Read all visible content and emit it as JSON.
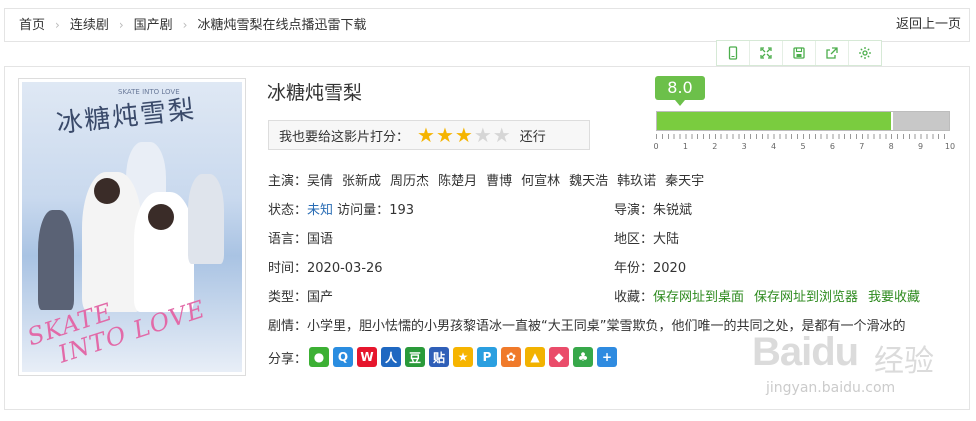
{
  "breadcrumb": {
    "items": [
      "首页",
      "连续剧",
      "国产剧",
      "冰糖炖雪梨在线点播迅雷下载"
    ],
    "separator": "›",
    "back": "返回上一页"
  },
  "toolbar": {
    "icons": [
      "mobile-icon",
      "fullscreen-icon",
      "save-icon",
      "share-out-icon",
      "settings-icon"
    ],
    "color": "#4cae4c"
  },
  "poster": {
    "title": "冰糖炖雪梨",
    "subtitle": "SKATE INTO LOVE",
    "script": [
      "SKATE",
      "INTO LOVE"
    ]
  },
  "movie": {
    "title": "冰糖炖雪梨"
  },
  "rating": {
    "prompt": "我也要给这影片打分：",
    "stars_on": 3,
    "stars_total": 5,
    "verdict": "还行"
  },
  "score": {
    "value": "8.0",
    "fraction": 0.8,
    "scale": [
      "0",
      "1",
      "2",
      "3",
      "4",
      "5",
      "6",
      "7",
      "8",
      "9",
      "10"
    ],
    "color": "#7acc3f"
  },
  "cast": {
    "label": "主演：",
    "names": [
      "吴倩",
      "张新成",
      "周历杰",
      "陈楚月",
      "曹博",
      "何宣林",
      "魏天浩",
      "韩玖诺",
      "秦天宇"
    ]
  },
  "info": {
    "status_label": "状态：",
    "status_value": "未知",
    "views_label": "访问量：",
    "views_value": "193",
    "director_label": "导演：",
    "director_value": "朱锐斌",
    "language_label": "语言：",
    "language_value": "国语",
    "region_label": "地区：",
    "region_value": "大陆",
    "date_label": "时间：",
    "date_value": "2020-03-26",
    "year_label": "年份：",
    "year_value": "2020",
    "type_label": "类型：",
    "type_value": "国产",
    "fav_label": "收藏：",
    "fav_links": [
      "保存网址到桌面",
      "保存网址到浏览器",
      "我要收藏"
    ],
    "plot_label": "剧情：",
    "plot_value": "小学里，胆小怯懦的小男孩黎语冰一直被“大王同桌”棠雪欺负，他们唯一的共同之处，是都有一个滑冰的"
  },
  "share": {
    "label": "分享：",
    "icons": [
      {
        "name": "wechat-icon",
        "color": "#3cb034",
        "glyph": "●"
      },
      {
        "name": "qq-icon",
        "color": "#2a8de0",
        "glyph": "Q"
      },
      {
        "name": "weibo-icon",
        "color": "#e6162d",
        "glyph": "W"
      },
      {
        "name": "renren-icon",
        "color": "#1f68c1",
        "glyph": "人"
      },
      {
        "name": "douban-icon",
        "color": "#2a9a3a",
        "glyph": "豆"
      },
      {
        "name": "tieba-icon",
        "color": "#2f5fb8",
        "glyph": "贴"
      },
      {
        "name": "qzone-icon",
        "color": "#f6b400",
        "glyph": "★"
      },
      {
        "name": "pengyou-icon",
        "color": "#2a9fe0",
        "glyph": "P"
      },
      {
        "name": "flower-icon",
        "color": "#f07a2a",
        "glyph": "✿"
      },
      {
        "name": "bookmark-icon",
        "color": "#f2b200",
        "glyph": "▲"
      },
      {
        "name": "youdao-icon",
        "color": "#ea4c6a",
        "glyph": "◆"
      },
      {
        "name": "clover-icon",
        "color": "#37a84a",
        "glyph": "♣"
      },
      {
        "name": "more-icon",
        "color": "#2f8be0",
        "glyph": "+"
      }
    ]
  },
  "watermark": {
    "logo": "Baidu",
    "cn": "经验",
    "url": "jingyan.baidu.com"
  }
}
